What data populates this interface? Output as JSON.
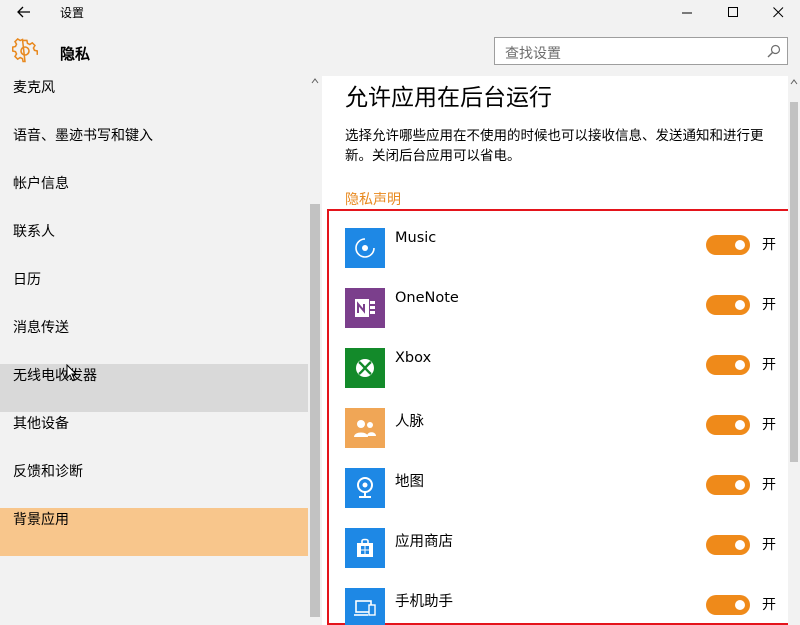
{
  "window": {
    "title": "设置",
    "controls": [
      "minimize",
      "maximize",
      "close"
    ]
  },
  "header": {
    "section_title": "隐私",
    "search": {
      "placeholder": "查找设置"
    }
  },
  "sidebar": {
    "items": [
      {
        "label": "麦克风"
      },
      {
        "label": "语音、墨迹书写和键入"
      },
      {
        "label": "帐户信息"
      },
      {
        "label": "联系人"
      },
      {
        "label": "日历"
      },
      {
        "label": "消息传送"
      },
      {
        "label": "无线电收发器",
        "state": "hover"
      },
      {
        "label": "其他设备"
      },
      {
        "label": "反馈和诊断"
      },
      {
        "label": "背景应用",
        "state": "selected"
      }
    ]
  },
  "main": {
    "heading": "允许应用在后台运行",
    "description": "选择允许哪些应用在不使用的时候也可以接收信息、发送通知和进行更新。关闭后台应用可以省电。",
    "privacy_link": "隐私声明",
    "apps": [
      {
        "name": "Music",
        "icon": "music-icon",
        "icon_color": "#1e88e5",
        "toggle": "开",
        "on": true
      },
      {
        "name": "OneNote",
        "icon": "onenote-icon",
        "icon_color": "#7b3f8c",
        "toggle": "开",
        "on": true
      },
      {
        "name": "Xbox",
        "icon": "xbox-icon",
        "icon_color": "#138a2a",
        "toggle": "开",
        "on": true
      },
      {
        "name": "人脉",
        "icon": "people-icon",
        "icon_color": "#f0a656",
        "toggle": "开",
        "on": true
      },
      {
        "name": "地图",
        "icon": "maps-icon",
        "icon_color": "#1e88e5",
        "toggle": "开",
        "on": true
      },
      {
        "name": "应用商店",
        "icon": "store-icon",
        "icon_color": "#1e88e5",
        "toggle": "开",
        "on": true
      },
      {
        "name": "手机助手",
        "icon": "phone-companion-icon",
        "icon_color": "#1e88e5",
        "toggle": "开",
        "on": true
      }
    ]
  },
  "colors": {
    "accent": "#ef8a1a",
    "selected_bg": "#f8c68c",
    "highlight_box": "#e4141b"
  }
}
